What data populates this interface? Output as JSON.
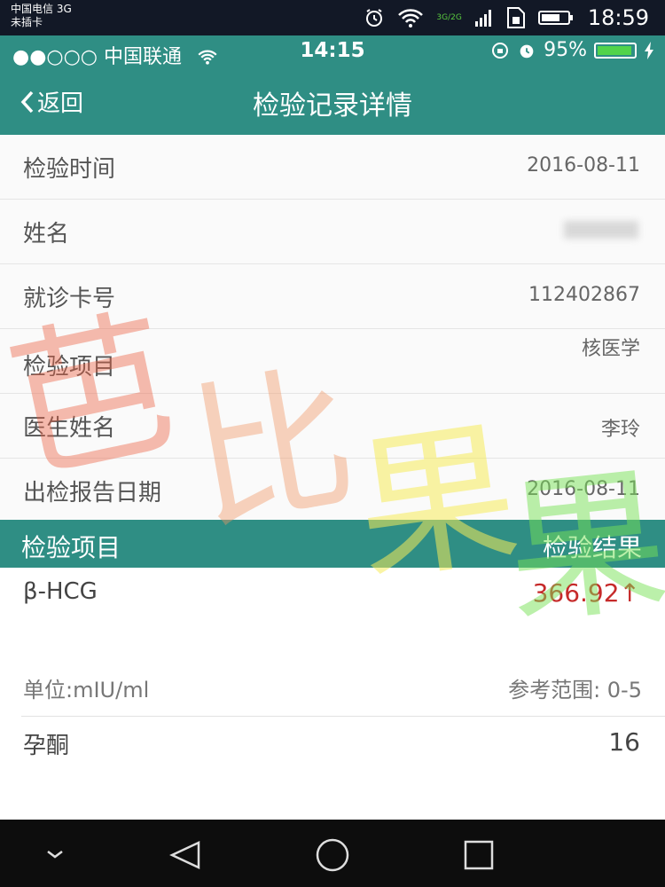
{
  "outer_status": {
    "carrier_line1": "中国电信 3G",
    "carrier_line2": "未插卡",
    "network_badge": "3G/2G",
    "time": "18:59",
    "icons": [
      "alarm-icon",
      "wifi-icon",
      "signal-icon",
      "sim-icon",
      "battery-icon"
    ]
  },
  "ios_status": {
    "carrier": "●●○○○ 中国联通",
    "time": "14:15",
    "battery": "95%",
    "icons": [
      "wifi-icon",
      "rotation-lock-icon",
      "alarm-icon",
      "battery-icon",
      "charging-icon"
    ]
  },
  "nav": {
    "back_label": "返回",
    "title": "检验记录详情"
  },
  "info_rows": [
    {
      "label": "检验时间",
      "value": "2016-08-11"
    },
    {
      "label": "姓名",
      "value": ""
    },
    {
      "label": "就诊卡号",
      "value": "112402867"
    },
    {
      "label": "检验项目",
      "value": "核医学"
    },
    {
      "label": "医生姓名",
      "value": "李玲"
    },
    {
      "label": "出检报告日期",
      "value": "2016-08-11"
    }
  ],
  "table_header": {
    "item": "检验项目",
    "result": "检验结果"
  },
  "results": [
    {
      "name": "β-HCG",
      "value": "366.92↑",
      "unit": "单位:mIU/ml",
      "range": "参考范围: 0-5"
    },
    {
      "name": "孕酮",
      "value": "16"
    }
  ],
  "watermark": [
    "芭",
    "比",
    "果",
    "果"
  ],
  "android_nav": [
    "chevron-down-icon",
    "back-triangle-icon",
    "home-circle-icon",
    "recents-square-icon"
  ],
  "colors": {
    "accent": "#2f8e84",
    "abnormal": "#c62a2a"
  }
}
